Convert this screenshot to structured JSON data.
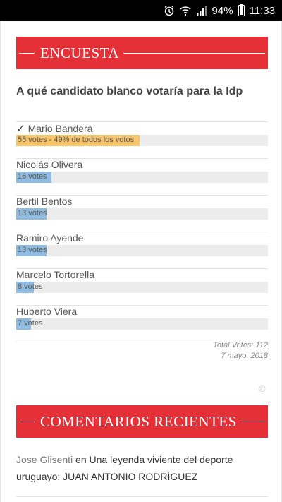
{
  "status_bar": {
    "battery": "94%",
    "time": "11:33",
    "icons": [
      "alarm-icon",
      "wifi-icon",
      "signal-icon",
      "battery-icon"
    ]
  },
  "poll": {
    "heading": "ENCUESTA",
    "question": "A qué candidato blanco votaría para la Idp",
    "options": [
      {
        "label": "Mario Bandera",
        "voted": true,
        "bar_text": "55 votes - 49% de todos los votos",
        "percent": 49
      },
      {
        "label": "Nicolás Olivera",
        "voted": false,
        "bar_text": "16 votes",
        "percent": 14
      },
      {
        "label": "Bertil Bentos",
        "voted": false,
        "bar_text": "13 votes",
        "percent": 12
      },
      {
        "label": "Ramiro Ayende",
        "voted": false,
        "bar_text": "13 votes",
        "percent": 12
      },
      {
        "label": "Marcelo Tortorella",
        "voted": false,
        "bar_text": "8 votes",
        "percent": 7
      },
      {
        "label": "Huberto Viera",
        "voted": false,
        "bar_text": "7 votes",
        "percent": 6
      }
    ],
    "total_votes": "Total Votes: 112",
    "date": "7 mayo, 2018",
    "copyright": "©"
  },
  "comments": {
    "heading": "COMENTARIOS RECIENTES",
    "items": [
      {
        "author": "Jose Glisenti",
        "connector": "en",
        "post_title": "Una leyenda viviente del deporte uruguayo: JUAN ANTONIO RODRÍGUEZ"
      }
    ]
  },
  "colors": {
    "accent": "#e53038",
    "voted_bar": "#f7c469",
    "bar": "#8fbbe0",
    "track": "#ececec"
  }
}
